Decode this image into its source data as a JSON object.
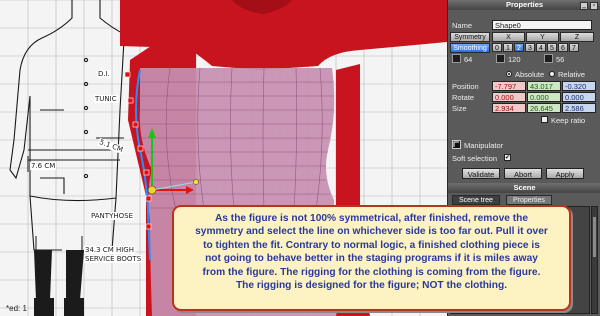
{
  "viewport": {
    "reference_labels": {
      "tunic": "TUNIC",
      "di": "D.I.",
      "cm_measure_1": "5.1 CM",
      "cm_measure_2": "7.6 CM",
      "pantyhose": "PANTYHOSE",
      "boots_line1": "34.3 CM HIGH",
      "boots_line2": "SERVICE BOOTS"
    },
    "status_text": "*ed: 1"
  },
  "properties": {
    "title": "Properties",
    "name_label": "Name",
    "name_value": "Shape0",
    "symmetry_label": "Symmetry",
    "axes": [
      "X",
      "Y",
      "Z"
    ],
    "smoothing_label": "Smoothing",
    "smoothing_levels": [
      "0",
      "1",
      "2",
      "3",
      "4",
      "5",
      "6",
      "7"
    ],
    "active_level": "2",
    "presets": [
      "64",
      "120",
      "56"
    ],
    "absolute_label": "Absolute",
    "relative_label": "Relative",
    "coordinate_mode": "Absolute",
    "position_label": "Position",
    "position": [
      "-7.797",
      "43.017",
      "-0.320"
    ],
    "rotate_label": "Rotate",
    "rotate": [
      "0.000",
      "0.000",
      "0.000"
    ],
    "size_label": "Size",
    "size": [
      "2.934",
      "26.645",
      "2.586"
    ],
    "keep_ratio_label": "Keep ratio",
    "manipulator_label": "Manipulator",
    "soft_selection_label": "Soft selection",
    "soft_selection_checked": "✔",
    "validate_label": "Validate",
    "abort_label": "Abort",
    "apply_label": "Apply"
  },
  "scene": {
    "title": "Scene",
    "tabs": [
      "Scene tree",
      "Properties"
    ],
    "active_tab": "Scene tree"
  },
  "callout": {
    "lines": [
      "As the figure is not 100% symmetrical, after finished, remove the",
      "symmetry and select the line on whichever side is too far out. Pull it over",
      "to tighten the fit. Contrary to normal logic, a finished clothing piece is",
      "not going to behave better in the staging programs if it is miles away",
      "from the figure. The rigging for the clothing is coming from the figure.",
      "The rigging is designed for the figure; NOT the clothing."
    ]
  },
  "colors": {
    "mesh_red": "#c8141e",
    "panel_bg": "#5a5a5a",
    "callout_bg": "#fdf3c2",
    "callout_border": "#b8331f",
    "callout_text": "#2a3a9a",
    "active_blue": "#2f6fd6"
  }
}
